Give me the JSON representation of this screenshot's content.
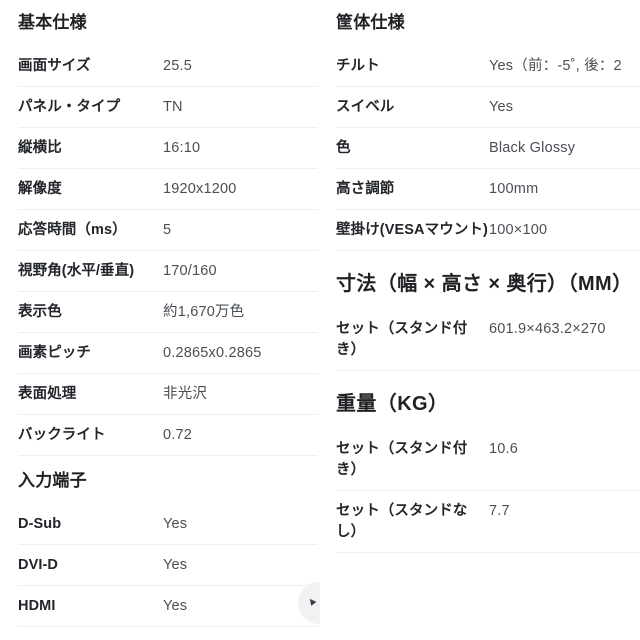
{
  "left_column": {
    "sections": [
      {
        "title": "基本仕様",
        "title_size": "normal",
        "rows": [
          {
            "label": "画面サイズ",
            "value": "25.5"
          },
          {
            "label": "パネル・タイプ",
            "value": "TN"
          },
          {
            "label": "縦横比",
            "value": "16:10"
          },
          {
            "label": "解像度",
            "value": "1920x1200"
          },
          {
            "label": "応答時間（ms）",
            "value": "5"
          },
          {
            "label": "視野角(水平/垂直)",
            "value": "170/160"
          },
          {
            "label": "表示色",
            "value": "約1,670万色"
          },
          {
            "label": "画素ピッチ",
            "value": "0.2865x0.2865"
          },
          {
            "label": "表面処理",
            "value": "非光沢"
          },
          {
            "label": "バックライト",
            "value": "0.72"
          }
        ]
      },
      {
        "title": "入力端子",
        "title_size": "normal",
        "rows": [
          {
            "label": "D-Sub",
            "value": "Yes"
          },
          {
            "label": "DVI-D",
            "value": "Yes"
          },
          {
            "label": "HDMI",
            "value": "Yes"
          }
        ]
      }
    ]
  },
  "right_column": {
    "sections": [
      {
        "title": "筐体仕様",
        "title_size": "normal",
        "rows": [
          {
            "label": "チルト",
            "value": "Yes（前：-5˚, 後：2"
          },
          {
            "label": "スイベル",
            "value": "Yes"
          },
          {
            "label": "色",
            "value": "Black Glossy"
          },
          {
            "label": "高さ調節",
            "value": "100mm"
          },
          {
            "label": "壁掛け(VESAマウント)",
            "value": "100×100"
          }
        ]
      },
      {
        "title": "寸法（幅 × 高さ × 奥行）（MM）",
        "title_size": "big",
        "rows": [
          {
            "label": "セット（スタンド付き）",
            "value": "601.9×463.2×270"
          }
        ]
      },
      {
        "title": "重量（KG）",
        "title_size": "big",
        "rows": [
          {
            "label": "セット（スタンド付き）",
            "value": "10.6"
          },
          {
            "label": "セット（スタンドなし）",
            "value": "7.7"
          }
        ]
      }
    ]
  },
  "floating_button": {
    "glyph": "▲",
    "color": "#f1f2f4"
  }
}
